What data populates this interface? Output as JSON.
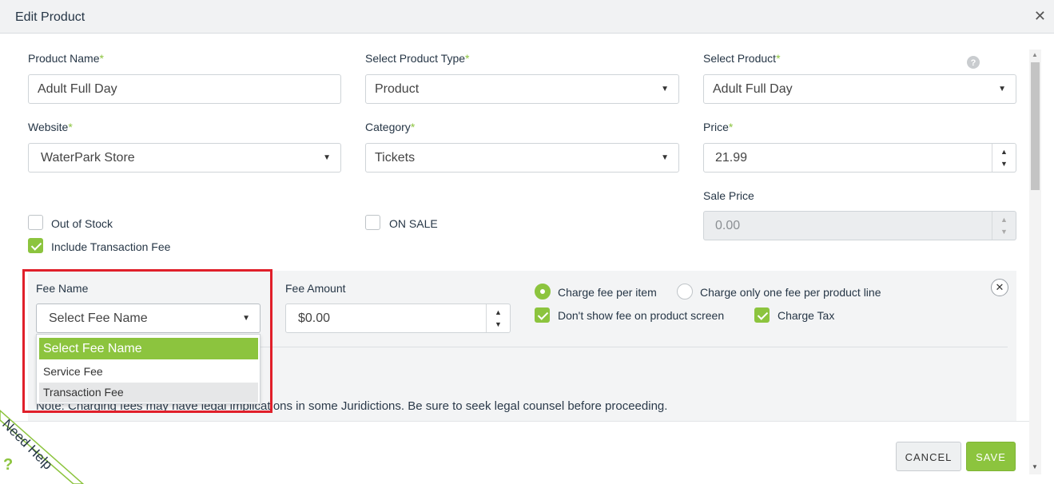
{
  "dialog": {
    "title": "Edit Product"
  },
  "fields": {
    "product_name": {
      "label": "Product Name",
      "value": "Adult Full Day"
    },
    "product_type": {
      "label": "Select Product Type",
      "value": "Product"
    },
    "select_product": {
      "label": "Select Product",
      "value": "Adult Full Day"
    },
    "website": {
      "label": "Website",
      "value": "WaterPark Store"
    },
    "category": {
      "label": "Category",
      "value": "Tickets"
    },
    "price": {
      "label": "Price",
      "value": "21.99"
    },
    "sale_price": {
      "label": "Sale Price",
      "value": "0.00"
    }
  },
  "required_mark": "*",
  "help_icon": "question-circle-icon",
  "checkboxes": {
    "out_of_stock": {
      "label": "Out of Stock",
      "checked": false
    },
    "on_sale": {
      "label": "ON SALE",
      "checked": false
    },
    "include_transaction_fee": {
      "label": "Include Transaction Fee",
      "checked": true
    }
  },
  "fee": {
    "name_label": "Fee Name",
    "name_value": "Select Fee Name",
    "amount_label": "Fee Amount",
    "amount_value": "$0.00",
    "charge_per_item": "Charge fee per item",
    "charge_one_per_line": "Charge only one fee per product line",
    "dont_show_fee": "Don't show fee on product screen",
    "charge_tax": "Charge Tax",
    "options": [
      "Select Fee Name",
      "Service Fee",
      "Transaction Fee"
    ],
    "note": "Note: Charging fees may have legal implications in some Juridictions. Be sure to seek legal counsel before proceeding."
  },
  "footer": {
    "cancel": "CANCEL",
    "save": "SAVE"
  },
  "need_help": "Need Help",
  "colors": {
    "accent": "#8cc43e",
    "highlight": "#e01f2a"
  }
}
